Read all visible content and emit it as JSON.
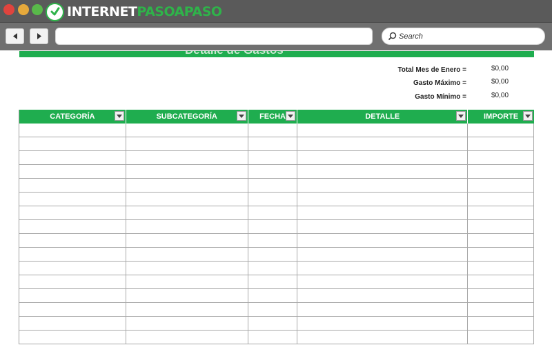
{
  "browser": {
    "logo": {
      "part1": "INTERNET",
      "part2": "PASOAPASO"
    },
    "search_placeholder": "Search",
    "url_value": ""
  },
  "sheet": {
    "title_partial": "Detalle de Gastos",
    "summary": [
      {
        "label": "Total Mes de Enero =",
        "value": "$0,00"
      },
      {
        "label": "Gasto Máximo =",
        "value": "$0,00"
      },
      {
        "label": "Gasto Mínimo =",
        "value": "$0,00"
      }
    ],
    "columns": [
      "CATEGORÍA",
      "SUBCATEGORÍA",
      "FECHA",
      "DETALLE",
      "IMPORTE"
    ]
  },
  "colors": {
    "header_green": "#1fad4f",
    "chrome_dark": "#5a5a5a",
    "chrome_toolbar": "#707070"
  },
  "icons": [
    "back-arrow-icon",
    "forward-arrow-icon",
    "search-icon",
    "dropdown-arrow-icon",
    "logo-check-icon"
  ]
}
